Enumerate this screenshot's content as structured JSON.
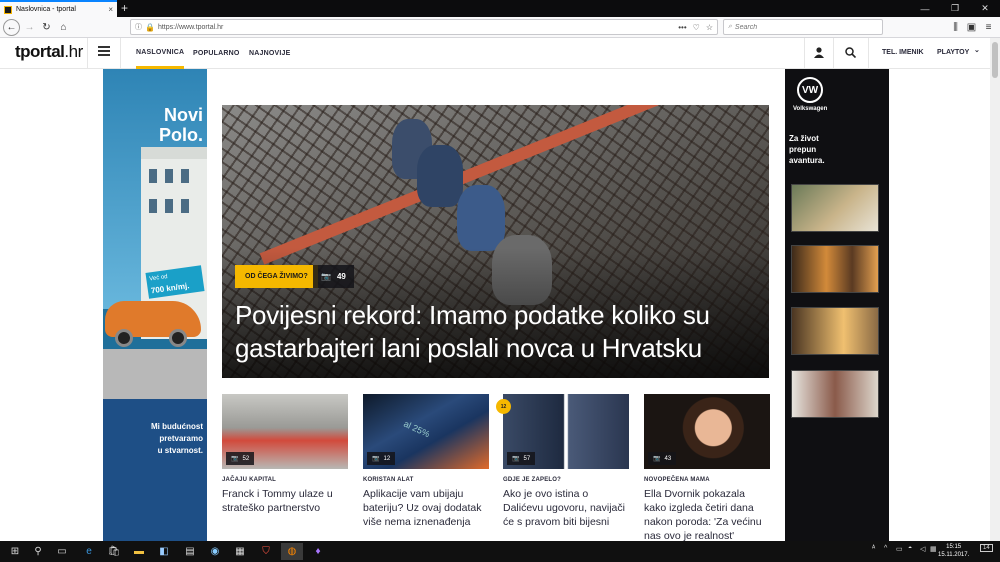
{
  "browser": {
    "tab_title": "Naslovnica - tportal",
    "tab_close": "×",
    "new_tab": "+",
    "url": "https://www.tportal.hr",
    "search_placeholder": "Search",
    "minimize": "—",
    "restore": "❐",
    "close": "✕",
    "url_actions": [
      "•••",
      "♡",
      "☆"
    ]
  },
  "site": {
    "logo_main": "tportal",
    "logo_suffix": ".hr",
    "nav": [
      "NASLOVNICA",
      "POPULARNO",
      "NAJNOVIJE"
    ],
    "phonebook": "TEL. IMENIK",
    "playtoy": "PLAYTOY",
    "playtoy_chevron": "⌄"
  },
  "left_ad": {
    "title_line1": "Novi",
    "title_line2": "Polo.",
    "speed_line1": "Već od",
    "speed_value": "700 kn/mj.",
    "slogan_line1": "Mi budućnost",
    "slogan_line2": "pretvaramo",
    "slogan_line3": "u stvarnost."
  },
  "right_ad": {
    "brand_mark": "VW",
    "brand": "Volkswagen",
    "tagline_line1": "Za život",
    "tagline_line2": "prepun",
    "tagline_line3": "avantura."
  },
  "feature": {
    "kicker": "OD ČEGA ŽIVIMO?",
    "photo_count": "49",
    "headline": "Povijesni rekord: Imamo podatke koliko su gastarbajteri lani poslali novca u Hrvatsku"
  },
  "cards": [
    {
      "count": "52",
      "kicker": "JAČAJU KAPITAL",
      "title": "Franck i Tommy ulaze u strateško partnerstvo"
    },
    {
      "count": "12",
      "kicker": "KORISTAN ALAT",
      "title": "Aplikacije vam ubijaju bateriju? Uz ovaj dodatak više nema iznenađenja"
    },
    {
      "count": "57",
      "kicker": "GDJE JE ZAPELO?",
      "title": "Ako je ovo istina o Dalićevu ugovoru, navijači će s pravom biti bijesni",
      "badge": "12"
    },
    {
      "count": "43",
      "kicker": "NOVOPEČENA MAMA",
      "title": "Ella Dvornik pokazala kako izgleda četiri dana nakon poroda: 'Za većinu nas ovo je realnost'"
    }
  ],
  "card_image_overlay": "al 25%",
  "taskbar": {
    "time": "15:15",
    "date": "15.11.2017.",
    "notifications": "14",
    "lang_icon": "ᴬ"
  },
  "colors": {
    "accent": "#f5b800",
    "browser_dark": "#0c0c0d",
    "nav_text": "#2a2a3a"
  }
}
